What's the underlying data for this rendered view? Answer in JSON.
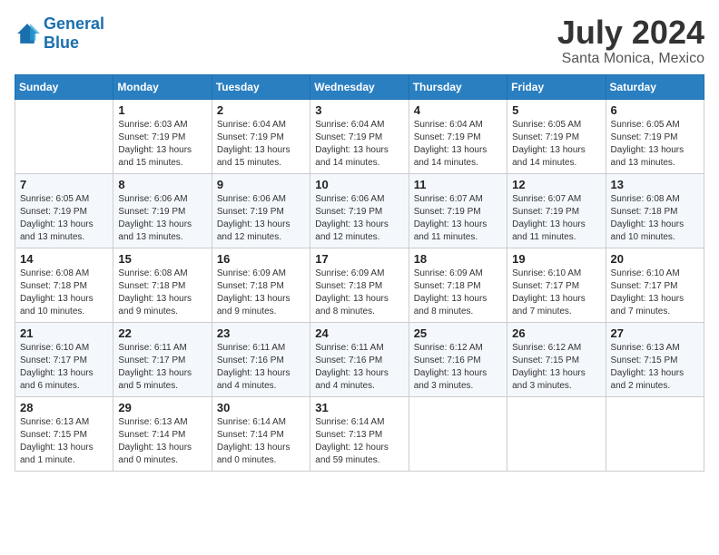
{
  "header": {
    "logo_line1": "General",
    "logo_line2": "Blue",
    "month": "July 2024",
    "location": "Santa Monica, Mexico"
  },
  "weekdays": [
    "Sunday",
    "Monday",
    "Tuesday",
    "Wednesday",
    "Thursday",
    "Friday",
    "Saturday"
  ],
  "weeks": [
    [
      {
        "day": "",
        "info": ""
      },
      {
        "day": "1",
        "info": "Sunrise: 6:03 AM\nSunset: 7:19 PM\nDaylight: 13 hours\nand 15 minutes."
      },
      {
        "day": "2",
        "info": "Sunrise: 6:04 AM\nSunset: 7:19 PM\nDaylight: 13 hours\nand 15 minutes."
      },
      {
        "day": "3",
        "info": "Sunrise: 6:04 AM\nSunset: 7:19 PM\nDaylight: 13 hours\nand 14 minutes."
      },
      {
        "day": "4",
        "info": "Sunrise: 6:04 AM\nSunset: 7:19 PM\nDaylight: 13 hours\nand 14 minutes."
      },
      {
        "day": "5",
        "info": "Sunrise: 6:05 AM\nSunset: 7:19 PM\nDaylight: 13 hours\nand 14 minutes."
      },
      {
        "day": "6",
        "info": "Sunrise: 6:05 AM\nSunset: 7:19 PM\nDaylight: 13 hours\nand 13 minutes."
      }
    ],
    [
      {
        "day": "7",
        "info": ""
      },
      {
        "day": "8",
        "info": "Sunrise: 6:06 AM\nSunset: 7:19 PM\nDaylight: 13 hours\nand 13 minutes."
      },
      {
        "day": "9",
        "info": "Sunrise: 6:06 AM\nSunset: 7:19 PM\nDaylight: 13 hours\nand 12 minutes."
      },
      {
        "day": "10",
        "info": "Sunrise: 6:06 AM\nSunset: 7:19 PM\nDaylight: 13 hours\nand 12 minutes."
      },
      {
        "day": "11",
        "info": "Sunrise: 6:07 AM\nSunset: 7:19 PM\nDaylight: 13 hours\nand 11 minutes."
      },
      {
        "day": "12",
        "info": "Sunrise: 6:07 AM\nSunset: 7:19 PM\nDaylight: 13 hours\nand 11 minutes."
      },
      {
        "day": "13",
        "info": "Sunrise: 6:08 AM\nSunset: 7:18 PM\nDaylight: 13 hours\nand 10 minutes."
      }
    ],
    [
      {
        "day": "14",
        "info": ""
      },
      {
        "day": "15",
        "info": "Sunrise: 6:08 AM\nSunset: 7:18 PM\nDaylight: 13 hours\nand 9 minutes."
      },
      {
        "day": "16",
        "info": "Sunrise: 6:09 AM\nSunset: 7:18 PM\nDaylight: 13 hours\nand 9 minutes."
      },
      {
        "day": "17",
        "info": "Sunrise: 6:09 AM\nSunset: 7:18 PM\nDaylight: 13 hours\nand 8 minutes."
      },
      {
        "day": "18",
        "info": "Sunrise: 6:09 AM\nSunset: 7:18 PM\nDaylight: 13 hours\nand 8 minutes."
      },
      {
        "day": "19",
        "info": "Sunrise: 6:10 AM\nSunset: 7:17 PM\nDaylight: 13 hours\nand 7 minutes."
      },
      {
        "day": "20",
        "info": "Sunrise: 6:10 AM\nSunset: 7:17 PM\nDaylight: 13 hours\nand 7 minutes."
      }
    ],
    [
      {
        "day": "21",
        "info": ""
      },
      {
        "day": "22",
        "info": "Sunrise: 6:11 AM\nSunset: 7:17 PM\nDaylight: 13 hours\nand 5 minutes."
      },
      {
        "day": "23",
        "info": "Sunrise: 6:11 AM\nSunset: 7:16 PM\nDaylight: 13 hours\nand 4 minutes."
      },
      {
        "day": "24",
        "info": "Sunrise: 6:11 AM\nSunset: 7:16 PM\nDaylight: 13 hours\nand 4 minutes."
      },
      {
        "day": "25",
        "info": "Sunrise: 6:12 AM\nSunset: 7:16 PM\nDaylight: 13 hours\nand 3 minutes."
      },
      {
        "day": "26",
        "info": "Sunrise: 6:12 AM\nSunset: 7:15 PM\nDaylight: 13 hours\nand 3 minutes."
      },
      {
        "day": "27",
        "info": "Sunrise: 6:13 AM\nSunset: 7:15 PM\nDaylight: 13 hours\nand 2 minutes."
      }
    ],
    [
      {
        "day": "28",
        "info": "Sunrise: 6:13 AM\nSunset: 7:15 PM\nDaylight: 13 hours\nand 1 minute."
      },
      {
        "day": "29",
        "info": "Sunrise: 6:13 AM\nSunset: 7:14 PM\nDaylight: 13 hours\nand 0 minutes."
      },
      {
        "day": "30",
        "info": "Sunrise: 6:14 AM\nSunset: 7:14 PM\nDaylight: 13 hours\nand 0 minutes."
      },
      {
        "day": "31",
        "info": "Sunrise: 6:14 AM\nSunset: 7:13 PM\nDaylight: 12 hours\nand 59 minutes."
      },
      {
        "day": "",
        "info": ""
      },
      {
        "day": "",
        "info": ""
      },
      {
        "day": "",
        "info": ""
      }
    ]
  ],
  "week1_day7_info": "Sunrise: 6:05 AM\nSunset: 7:19 PM\nDaylight: 13 hours\nand 13 minutes.",
  "week2_day14_info": "Sunrise: 6:08 AM\nSunset: 7:18 PM\nDaylight: 13 hours\nand 10 minutes.",
  "week3_day21_info": "Sunrise: 6:10 AM\nSunset: 7:17 PM\nDaylight: 13 hours\nand 6 minutes."
}
